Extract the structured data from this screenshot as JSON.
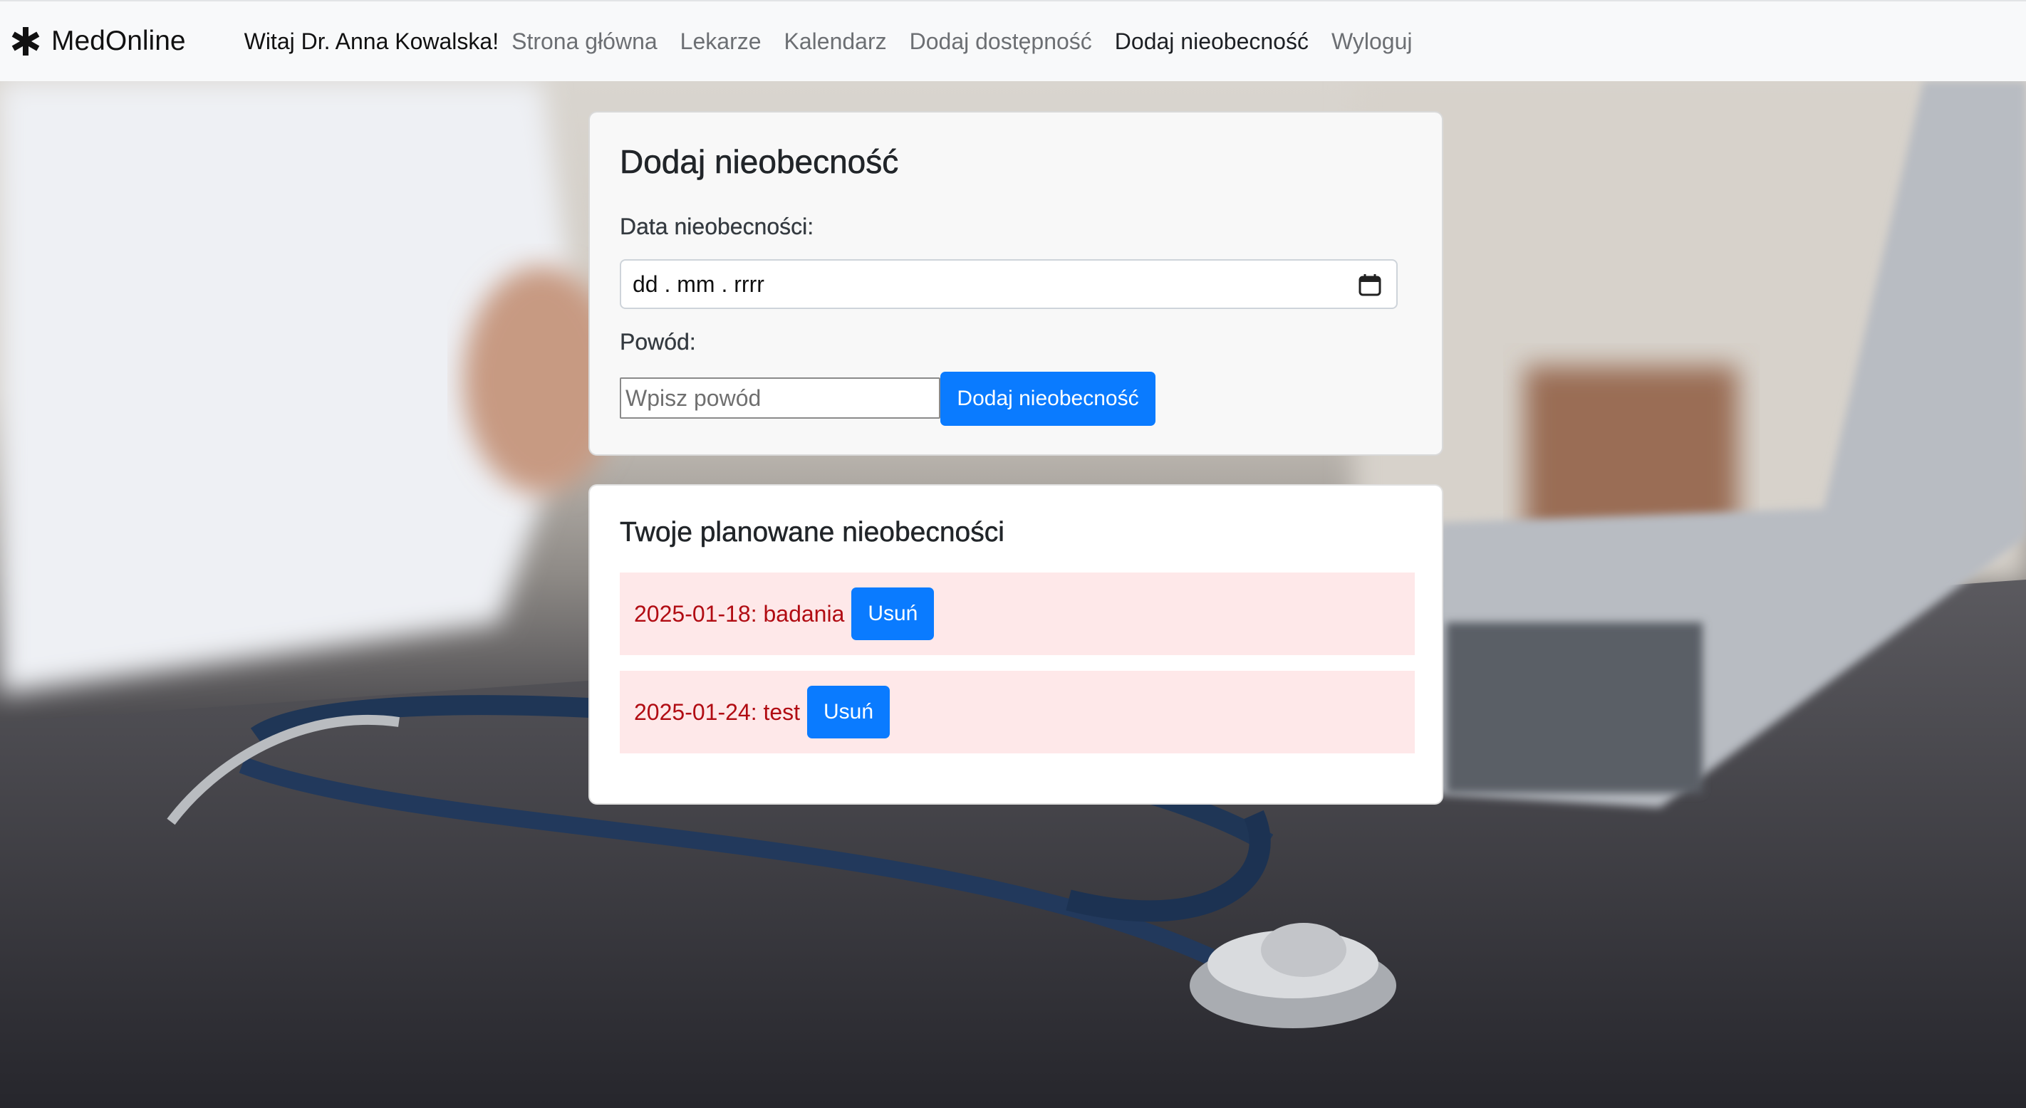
{
  "navbar": {
    "brand": "MedOnline",
    "brand_icon": "asterisk-icon",
    "welcome": "Witaj Dr. Anna Kowalska!",
    "links": [
      {
        "label": "Strona główna",
        "active": false
      },
      {
        "label": "Lekarze",
        "active": false
      },
      {
        "label": "Kalendarz",
        "active": false
      },
      {
        "label": "Dodaj dostępność",
        "active": false
      },
      {
        "label": "Dodaj nieobecność",
        "active": true
      },
      {
        "label": "Wyloguj",
        "active": false
      }
    ]
  },
  "form": {
    "title": "Dodaj nieobecność",
    "date_label": "Data nieobecności:",
    "date_value": "dd . mm . rrrr",
    "date_icon": "calendar-icon",
    "reason_label": "Powód:",
    "reason_placeholder": "Wpisz powód",
    "reason_value": "",
    "submit_label": "Dodaj nieobecność"
  },
  "absences": {
    "title": "Twoje planowane nieobecności",
    "items": [
      {
        "text": "2025-01-18: badania",
        "delete_label": "Usuń"
      },
      {
        "text": "2025-01-24: test",
        "delete_label": "Usuń"
      }
    ]
  },
  "colors": {
    "primary": "#0a7bff",
    "absence_bg": "#fee8e9",
    "absence_text": "#b10c13",
    "navbar_bg": "#f8f9fa"
  }
}
